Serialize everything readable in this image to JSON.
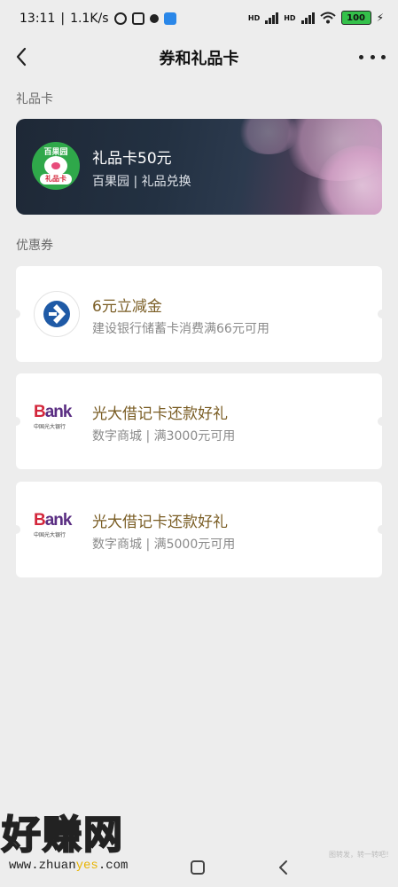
{
  "status_bar": {
    "time": "13:11",
    "speed": "1.1K/s",
    "hd1": "HD",
    "hd2": "HD",
    "battery": "100"
  },
  "header": {
    "title": "券和礼品卡",
    "back_icon": "chevron-left-icon",
    "more_icon": "more-icon"
  },
  "sections": {
    "gift_label": "礼品卡",
    "coupon_label": "优惠券"
  },
  "gift_card": {
    "logo_top": "百果园",
    "logo_bottom": "礼品卡",
    "title": "礼品卡50元",
    "subtitle": "百果园 | 礼品兑换"
  },
  "coupons": [
    {
      "title": "6元立减金",
      "subtitle": "建设银行储蓄卡消费满66元可用",
      "logo": "ccb-logo"
    },
    {
      "title": "光大借记卡还款好礼",
      "subtitle": "数字商城 | 满3000元可用",
      "logo": "ceb-logo",
      "logo_word_b": "B",
      "logo_word": "ank",
      "logo_cn": "中国光大银行"
    },
    {
      "title": "光大借记卡还款好礼",
      "subtitle": "数字商城 | 满5000元可用",
      "logo": "ceb-logo",
      "logo_word_b": "B",
      "logo_word": "ank",
      "logo_cn": "中国光大银行"
    }
  ],
  "watermark": {
    "big": "好赚网",
    "url_a": "www.zhuan",
    "url_b": "yes",
    "url_c": ".com",
    "corner": "图转发，转一转吧！"
  }
}
